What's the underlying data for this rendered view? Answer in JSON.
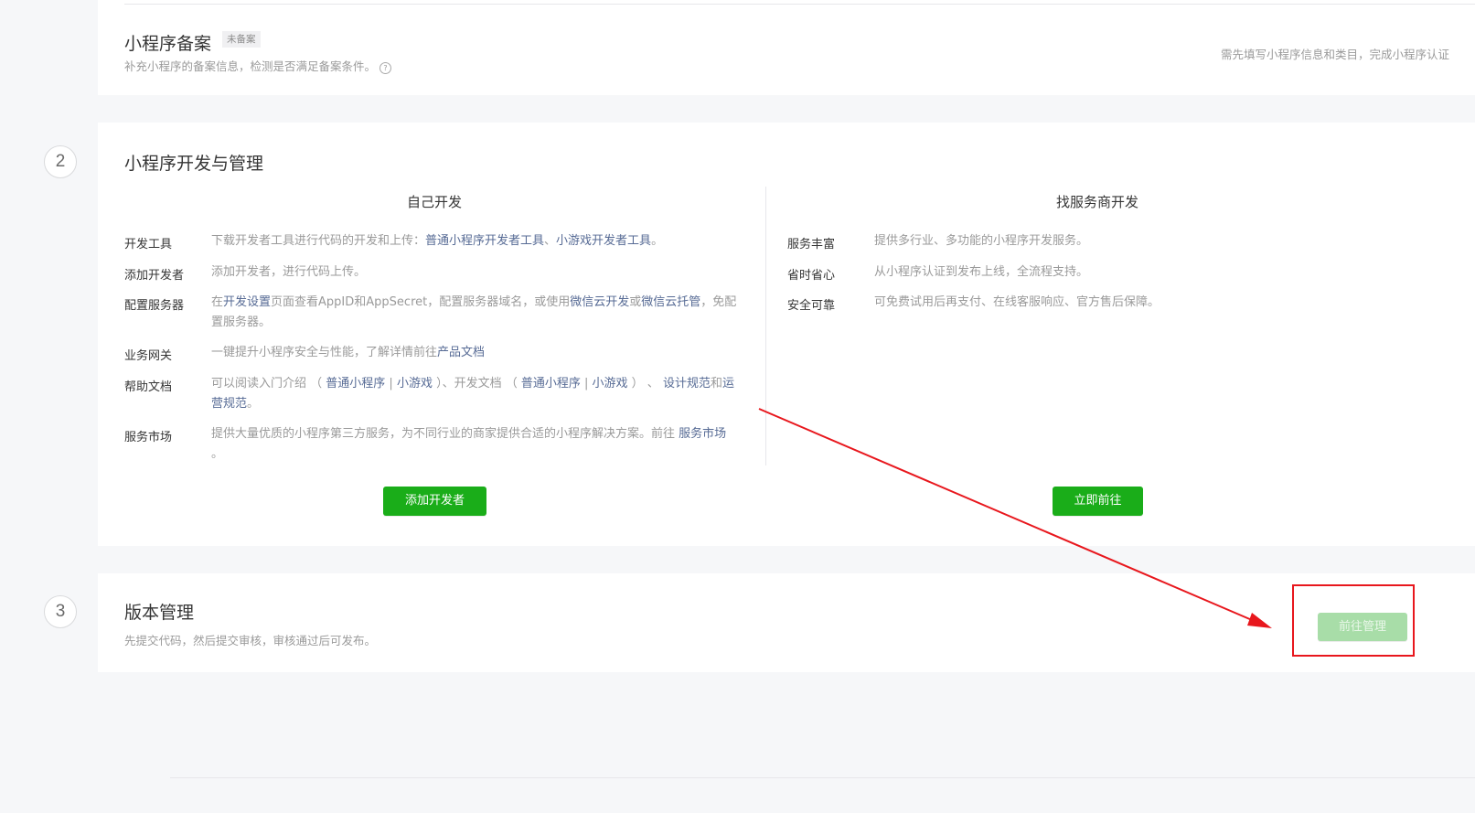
{
  "section1": {
    "title": "小程序备案",
    "badge": "未备案",
    "desc": "补充小程序的备案信息，检测是否满足备案条件。",
    "help_icon": "?",
    "right_note": "需先填写小程序信息和类目，完成小程序认证"
  },
  "section2": {
    "step": "2",
    "title": "小程序开发与管理",
    "left": {
      "title": "自己开发",
      "rows": [
        {
          "label": "开发工具",
          "prefix": "下载开发者工具进行代码的开发和上传：",
          "link1": "普通小程序开发者工具",
          "sep": "、",
          "link2": "小游戏开发者工具",
          "suffix": "。"
        },
        {
          "label": "添加开发者",
          "text": "添加开发者，进行代码上传。"
        },
        {
          "label": "配置服务器",
          "t1": "在",
          "link1": "开发设置",
          "t2": "页面查看AppID和AppSecret，配置服务器域名，或使用",
          "link2": "微信云开发",
          "t3": "或",
          "link3": "微信云托管",
          "t4": "，免配置服务器。"
        },
        {
          "label": "业务网关",
          "t1": "一键提升小程序安全与性能，了解详情前往",
          "link1": "产品文档"
        },
        {
          "label": "帮助文档",
          "t1": "可以阅读入门介绍 （ ",
          "link1": "普通小程序",
          "sepA": " | ",
          "link2": "小游戏",
          "t2": " ）、开发文档 （ ",
          "link3": "普通小程序",
          "sepB": " | ",
          "link4": "小游戏",
          "t3": " ） 、 ",
          "link5": "设计规范",
          "t4": "和",
          "link6": "运营规范",
          "t5": "。"
        },
        {
          "label": "服务市场",
          "t1": "提供大量优质的小程序第三方服务，为不同行业的商家提供合适的小程序解决方案。前往 ",
          "link1": "服务市场",
          "t2": " 。"
        }
      ],
      "button": "添加开发者"
    },
    "right": {
      "title": "找服务商开发",
      "rows": [
        {
          "label": "服务丰富",
          "text": "提供多行业、多功能的小程序开发服务。"
        },
        {
          "label": "省时省心",
          "text": "从小程序认证到发布上线，全流程支持。"
        },
        {
          "label": "安全可靠",
          "text": "可免费试用后再支付、在线客服响应、官方售后保障。"
        }
      ],
      "button": "立即前往"
    }
  },
  "section3": {
    "step": "3",
    "title": "版本管理",
    "desc": "先提交代码，然后提交审核，审核通过后可发布。",
    "button": "前往管理"
  },
  "colors": {
    "primary_green": "#1aad19",
    "link_blue": "#576b95",
    "annotation_red": "#e8171d"
  }
}
